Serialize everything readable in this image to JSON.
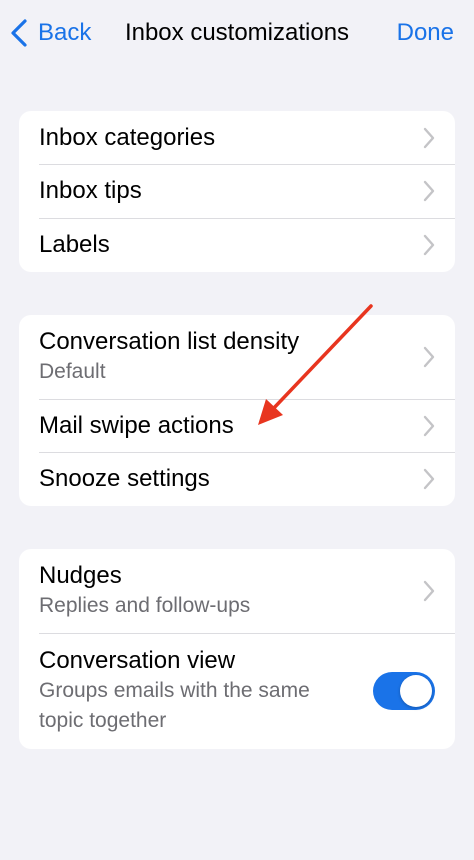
{
  "navbar": {
    "back_label": "Back",
    "title": "Inbox customizations",
    "done_label": "Done"
  },
  "group1": {
    "items": [
      {
        "label": "Inbox categories"
      },
      {
        "label": "Inbox tips"
      },
      {
        "label": "Labels"
      }
    ]
  },
  "group2": {
    "items": [
      {
        "label": "Conversation list density",
        "subtitle": "Default"
      },
      {
        "label": "Mail swipe actions"
      },
      {
        "label": "Snooze settings"
      }
    ]
  },
  "group3": {
    "nudges": {
      "label": "Nudges",
      "subtitle": "Replies and follow-ups"
    },
    "conversation_view": {
      "label": "Conversation view",
      "subtitle_line1": "Groups emails with the same",
      "subtitle_line2": "topic together",
      "enabled": true
    }
  },
  "colors": {
    "accent": "#1a73e8",
    "background": "#f2f2f7",
    "annotation_arrow": "#e8351f"
  },
  "icons": {
    "back": "chevron-left-icon",
    "row_disclosure": "chevron-right-icon"
  }
}
